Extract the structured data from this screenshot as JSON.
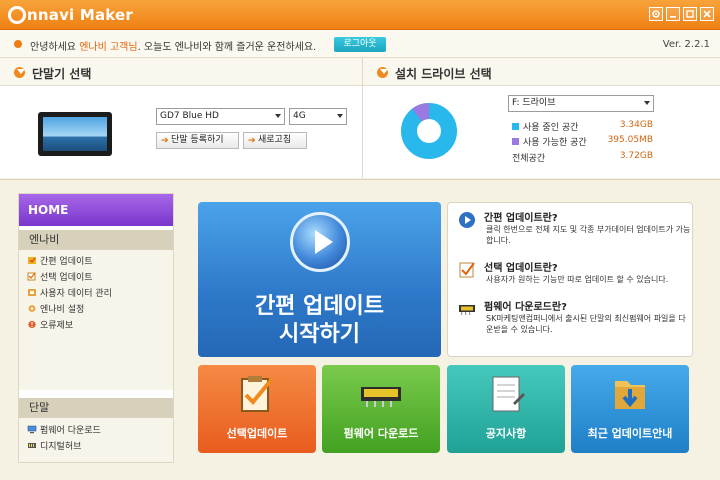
{
  "app": {
    "logo_initial": "C",
    "logo_text": "nnavi Maker",
    "version": "Ver. 2.2.1"
  },
  "window_controls": [
    "settings-icon",
    "minimize-icon",
    "restore-icon",
    "close-icon"
  ],
  "greeting": {
    "prefix": "안녕하세요",
    "user": "엔나비 고객님",
    "suffix": ". 오늘도 엔나비와 함께 즐거운 운전하세요.",
    "logout_label": "로그아웃"
  },
  "device_panel": {
    "title": "단말기 선택",
    "model_select": "GD7 Blue HD",
    "capacity_select": "4G",
    "register_button": "단말 등록하기",
    "refresh_button": "새로고침"
  },
  "drive_panel": {
    "title": "설치 드라이브 선택",
    "drive_select": "F: 드라이브",
    "used_label": "사용 중인 공간",
    "used_value": "3.34GB",
    "free_label": "사용 가능한 공간",
    "free_value": "395.05MB",
    "total_label": "전체공간",
    "total_value": "3.72GB",
    "used_fraction": 0.897,
    "colors": {
      "used": "#29b8ec",
      "free": "#9a79e0"
    }
  },
  "sidebar": {
    "home_label": "HOME",
    "sections": [
      {
        "title": "엔나비",
        "items": [
          "간편 업데이트",
          "선택 업데이트",
          "사용자 데이터 관리",
          "엔나비 설정",
          "오류제보"
        ]
      },
      {
        "title": "단말",
        "items": [
          "펌웨어 다운로드",
          "디지털허브"
        ]
      }
    ]
  },
  "main": {
    "big_tile": {
      "line1": "간편 업데이트",
      "line2": "시작하기"
    },
    "info": [
      {
        "title": "간편 업데이트란?",
        "desc": "클릭 한번으로 전체 지도 및 각종 부가데이터 업데이트가 가능합니다."
      },
      {
        "title": "선택 업데이트란?",
        "desc": "사용자가 원하는 기능만 따로 업데이트 할 수 있습니다."
      },
      {
        "title": "펌웨어 다운로드란?",
        "desc": "SK마케팅앤컴퍼니에서 출시된 단말의 최신펌웨어 파일을 다운받을 수 있습니다."
      }
    ],
    "tiles": [
      {
        "label": "선택업데이트",
        "color": "#ef6a26"
      },
      {
        "label": "펌웨어 다운로드",
        "color": "#4cae2c"
      },
      {
        "label": "공지사항",
        "color": "#2bb3a7"
      },
      {
        "label": "최근 업데이트안내",
        "color": "#2a93d6"
      }
    ]
  }
}
